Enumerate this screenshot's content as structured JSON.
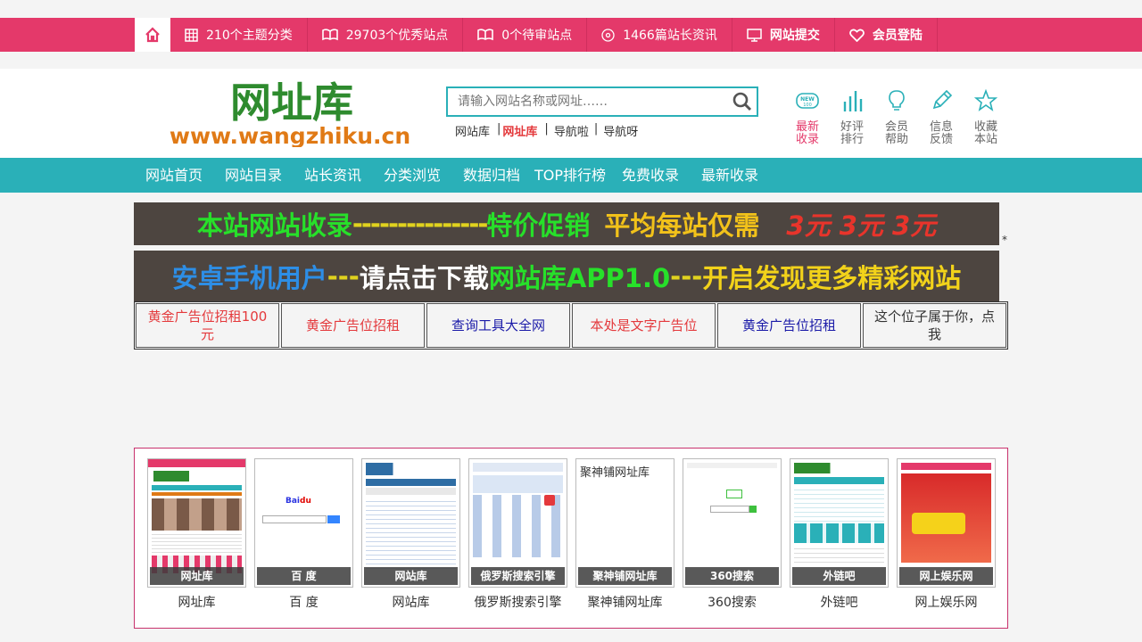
{
  "topbar": {
    "items": [
      {
        "label": "210个主题分类",
        "icon": "grid-icon"
      },
      {
        "label": "29703个优秀站点",
        "icon": "book-icon"
      },
      {
        "label": "0个待审站点",
        "icon": "book-icon"
      },
      {
        "label": "1466篇站长资讯",
        "icon": "disc-icon"
      },
      {
        "label": "网站提交",
        "icon": "monitor-icon"
      },
      {
        "label": "会员登陆",
        "icon": "heart-icon"
      }
    ]
  },
  "header": {
    "logo": {
      "main": "网址库",
      "url": "www.wangzhiku.cn"
    },
    "search_placeholder": "请输入网站名称或网址……",
    "sublinks": [
      "网站库",
      "网址库",
      "导航啦",
      "导航呀"
    ],
    "quick": [
      {
        "line1": "最新",
        "line2": "收录",
        "icon": "new-badge-icon"
      },
      {
        "line1": "好评",
        "line2": "排行",
        "icon": "bar-chart-icon"
      },
      {
        "line1": "会员",
        "line2": "帮助",
        "icon": "lightbulb-icon"
      },
      {
        "line1": "信息",
        "line2": "反馈",
        "icon": "pencil-icon"
      },
      {
        "line1": "收藏",
        "line2": "本站",
        "icon": "star-icon"
      }
    ]
  },
  "nav": [
    "网站首页",
    "网站目录",
    "站长资讯",
    "分类浏览",
    "数据归档",
    "TOP排行榜",
    "免费收录",
    "最新收录"
  ],
  "banners": {
    "one": {
      "a": "本站网站收录",
      "b": "---------------",
      "c": "特价促销",
      "d": "平均每站仅需",
      "e": "3元 3元 3元"
    },
    "two": {
      "a": "安卓手机用户",
      "b": "---",
      "c": "请点击下载",
      "d": "网站库APP1.0",
      "e": "---",
      "f": "开启发现更多精彩网站"
    },
    "star": "*"
  },
  "ads": [
    "黄金广告位招租100元",
    "黄金广告位招租",
    "查询工具大全网",
    "本处是文字广告位",
    "黄金广告位招租",
    "这个位子属于你，点我"
  ],
  "colors": {
    "topbar": "#e4396a",
    "nav": "#2ab0b8",
    "ad_red": "#e4393c",
    "ad_blue": "#1a1aa8"
  },
  "showcase": [
    {
      "name": "网址库",
      "label": "网址库"
    },
    {
      "name": "百 度",
      "label": "百 度"
    },
    {
      "name": "网站库",
      "label": "网站库"
    },
    {
      "name": "俄罗斯搜索引擎",
      "label": "俄罗斯搜索引擎"
    },
    {
      "name": "聚神铺网址库",
      "label": "聚神铺网址库",
      "alt": "聚神铺网址库"
    },
    {
      "name": "360搜索",
      "label": "360搜索"
    },
    {
      "name": "外链吧",
      "label": "外链吧"
    },
    {
      "name": "网上娱乐网",
      "label": "网上娱乐网"
    }
  ]
}
